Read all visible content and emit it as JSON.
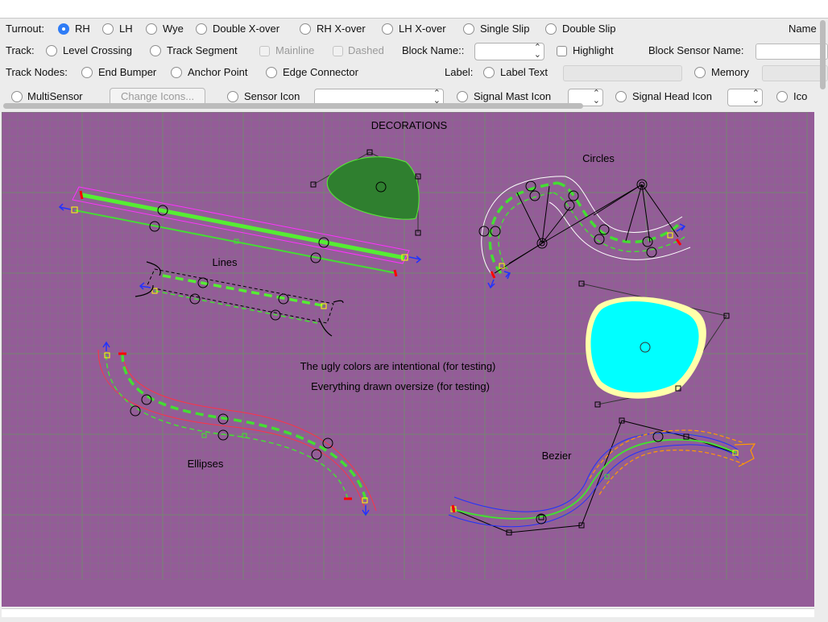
{
  "toolbar": {
    "row1": {
      "label": "Turnout:",
      "options": [
        "RH",
        "LH",
        "Wye",
        "Double X-over",
        "RH X-over",
        "LH X-over",
        "Single Slip",
        "Double Slip"
      ],
      "selected": "RH",
      "name_label": "Name"
    },
    "row2": {
      "label": "Track:",
      "options": [
        "Level Crossing",
        "Track Segment"
      ],
      "mainline_label": "Mainline",
      "dashed_label": "Dashed",
      "block_name_label": "Block Name::",
      "block_name_value": "",
      "highlight_label": "Highlight",
      "block_sensor_label": "Block Sensor Name:",
      "block_sensor_value": ""
    },
    "row3": {
      "label": "Track Nodes:",
      "options": [
        "End Bumper",
        "Anchor Point",
        "Edge Connector"
      ],
      "label_label": "Label:",
      "label_text_option": "Label Text",
      "label_text_value": "",
      "memory_option": "Memory"
    },
    "row4": {
      "multisensor": "MultiSensor",
      "change_icons_button": "Change Icons...",
      "sensor_icon": "Sensor Icon",
      "signal_mast_icon": "Signal Mast Icon",
      "signal_head_icon": "Signal Head Icon",
      "icon_option": "Ico"
    }
  },
  "canvas": {
    "title": "DECORATIONS",
    "section_labels": [
      "Lines",
      "Circles",
      "Ellipses",
      "Bezier"
    ],
    "notes": [
      "The ugly colors are intentional (for testing)",
      "Everything drawn oversize (for testing)"
    ]
  },
  "colors": {
    "canvas_background": "#945c98",
    "grid": "#6f8a6a",
    "mainline_track": "#55ee33",
    "side_track": "#44dd33",
    "bumper_tick": "#ff0000",
    "arrow": "#2233ff",
    "rail_outline": "#ff3344",
    "shape_dark_green": "#2f7f2f",
    "shape_cyan": "#00ffff",
    "shape_cyan_border": "#ffffaa",
    "radio_selected": "#2f7cf6"
  }
}
